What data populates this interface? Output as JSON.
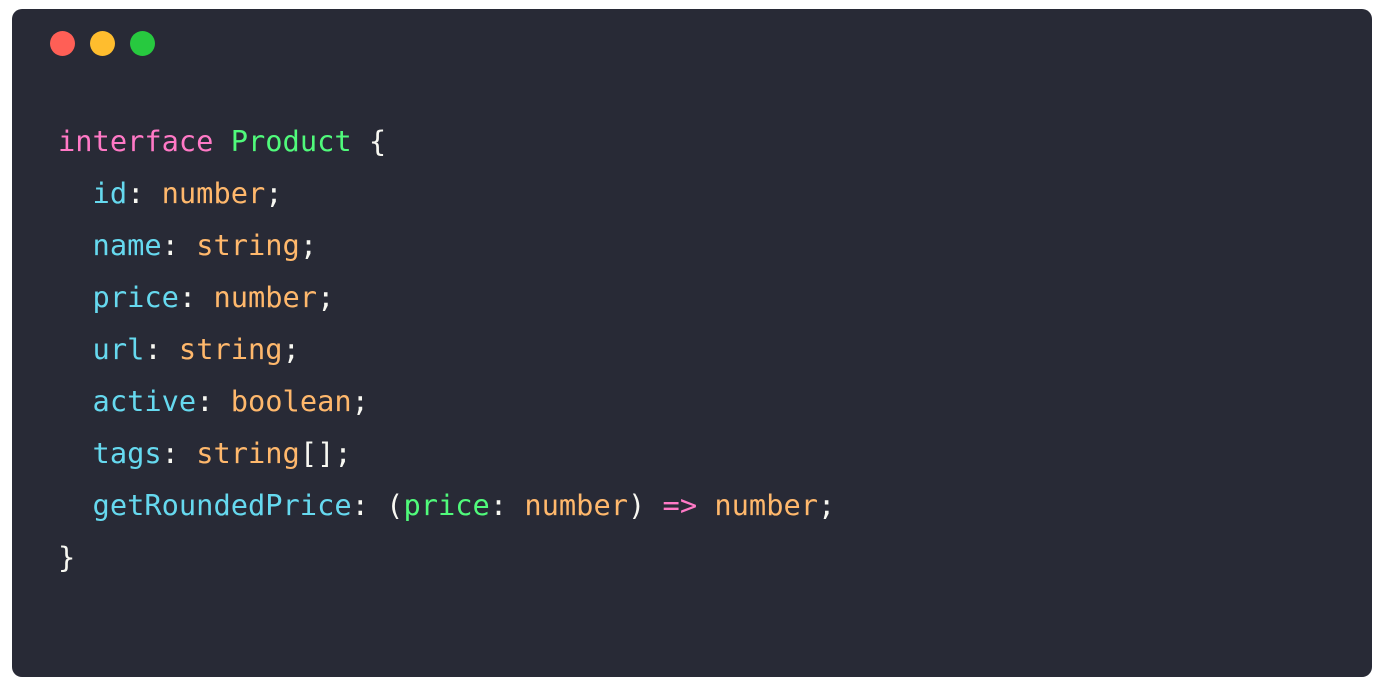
{
  "window": {
    "controls": [
      {
        "name": "close",
        "color": "#ff5f56"
      },
      {
        "name": "minimize",
        "color": "#ffbd2e"
      },
      {
        "name": "maximize",
        "color": "#27c93f"
      }
    ]
  },
  "colors": {
    "background": "#282a36",
    "keyword": "#ff79c6",
    "type_name": "#50fa7b",
    "property": "#66d9ef",
    "type": "#ffb86c",
    "punctuation": "#f8f8f2",
    "param": "#50fa7b"
  },
  "code": {
    "language": "typescript",
    "lines": [
      [
        {
          "t": "interface",
          "k": "keyword"
        },
        {
          "t": " ",
          "k": "punctuation"
        },
        {
          "t": "Product",
          "k": "type_name"
        },
        {
          "t": " {",
          "k": "punctuation"
        }
      ],
      [
        {
          "t": "  ",
          "k": "punctuation"
        },
        {
          "t": "id",
          "k": "property"
        },
        {
          "t": ": ",
          "k": "punctuation"
        },
        {
          "t": "number",
          "k": "type"
        },
        {
          "t": ";",
          "k": "punctuation"
        }
      ],
      [
        {
          "t": "  ",
          "k": "punctuation"
        },
        {
          "t": "name",
          "k": "property"
        },
        {
          "t": ": ",
          "k": "punctuation"
        },
        {
          "t": "string",
          "k": "type"
        },
        {
          "t": ";",
          "k": "punctuation"
        }
      ],
      [
        {
          "t": "  ",
          "k": "punctuation"
        },
        {
          "t": "price",
          "k": "property"
        },
        {
          "t": ": ",
          "k": "punctuation"
        },
        {
          "t": "number",
          "k": "type"
        },
        {
          "t": ";",
          "k": "punctuation"
        }
      ],
      [
        {
          "t": "  ",
          "k": "punctuation"
        },
        {
          "t": "url",
          "k": "property"
        },
        {
          "t": ": ",
          "k": "punctuation"
        },
        {
          "t": "string",
          "k": "type"
        },
        {
          "t": ";",
          "k": "punctuation"
        }
      ],
      [
        {
          "t": "  ",
          "k": "punctuation"
        },
        {
          "t": "active",
          "k": "property"
        },
        {
          "t": ": ",
          "k": "punctuation"
        },
        {
          "t": "boolean",
          "k": "type"
        },
        {
          "t": ";",
          "k": "punctuation"
        }
      ],
      [
        {
          "t": "  ",
          "k": "punctuation"
        },
        {
          "t": "tags",
          "k": "property"
        },
        {
          "t": ": ",
          "k": "punctuation"
        },
        {
          "t": "string",
          "k": "type"
        },
        {
          "t": "[];",
          "k": "punctuation"
        }
      ],
      [
        {
          "t": "  ",
          "k": "punctuation"
        },
        {
          "t": "getRoundedPrice",
          "k": "property"
        },
        {
          "t": ": (",
          "k": "punctuation"
        },
        {
          "t": "price",
          "k": "param"
        },
        {
          "t": ": ",
          "k": "punctuation"
        },
        {
          "t": "number",
          "k": "type"
        },
        {
          "t": ") ",
          "k": "punctuation"
        },
        {
          "t": "=>",
          "k": "keyword"
        },
        {
          "t": " ",
          "k": "punctuation"
        },
        {
          "t": "number",
          "k": "type"
        },
        {
          "t": ";",
          "k": "punctuation"
        }
      ],
      [
        {
          "t": "}",
          "k": "punctuation"
        }
      ]
    ]
  }
}
